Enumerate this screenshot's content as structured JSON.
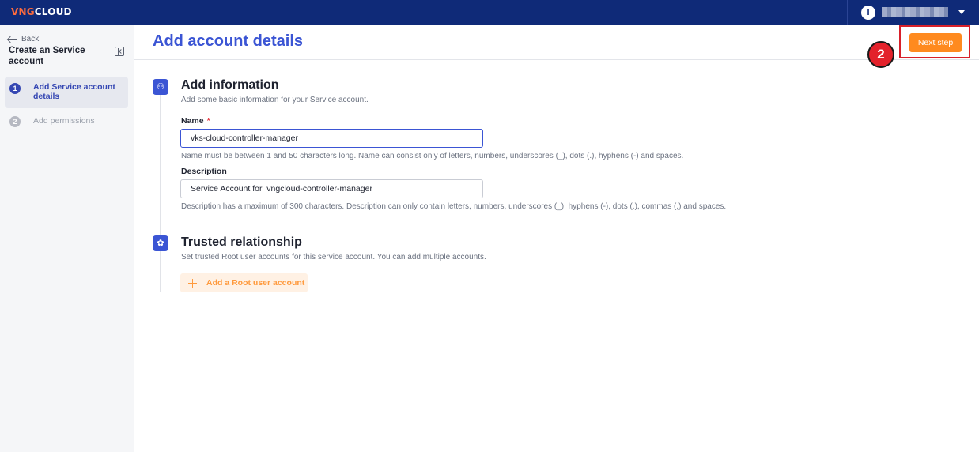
{
  "topbar": {
    "logo_brand": "VNG",
    "logo_rest": "CLOUD",
    "user_initial": "I"
  },
  "sidebar": {
    "back_label": "Back",
    "title": "Create an Service account",
    "steps": [
      {
        "number": "1",
        "label": "Add Service account details",
        "active": true
      },
      {
        "number": "2",
        "label": "Add permissions",
        "active": false
      }
    ]
  },
  "header": {
    "title": "Add account details",
    "next_button": "Next step",
    "callout_number": "2"
  },
  "add_information": {
    "title": "Add information",
    "description": "Add some basic information for your Service account.",
    "name_label": "Name",
    "name_required_mark": "*",
    "name_value": "vks-cloud-controller-manager",
    "name_help": "Name must be between 1 and 50 characters long. Name can consist only of letters, numbers, underscores (_), dots (.), hyphens (-) and spaces.",
    "description_label": "Description",
    "description_value": "Service Account for  vngcloud-controller-manager",
    "description_help": "Description has a maximum of 300 characters. Description can only contain letters, numbers, underscores (_), hyphens (-), dots (.), commas (,) and spaces."
  },
  "trusted_relationship": {
    "title": "Trusted relationship",
    "description": "Set trusted Root user accounts for this service account. You can add multiple accounts.",
    "add_button": "Add a Root user account"
  },
  "colors": {
    "topbar": "#0f2a78",
    "accent_blue": "#3b55d4",
    "orange": "#ff8a1f",
    "highlight_red": "#d8202a"
  }
}
